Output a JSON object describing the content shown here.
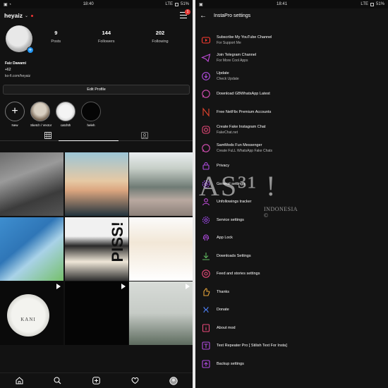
{
  "left": {
    "status": {
      "time": "18:40",
      "signal": "LTE",
      "battery": "51%"
    },
    "topbar": {
      "username": "heyaiz",
      "notif_count": "1"
    },
    "profile": {
      "stats": [
        {
          "value": "9",
          "label": "Posts"
        },
        {
          "value": "144",
          "label": "Followers"
        },
        {
          "value": "202",
          "label": "Following"
        }
      ],
      "name": "Faiz Dawami",
      "pronoun": "+62",
      "link": "ko-fi.com/heyaiz",
      "edit_label": "Edit Profile"
    },
    "highlights": [
      {
        "label": "New"
      },
      {
        "label": "Sketch / Vector"
      },
      {
        "label": "catchth"
      },
      {
        "label": "heleh"
      }
    ],
    "grid": {
      "piss_text": "PISS!",
      "lamp_text": "KANI"
    }
  },
  "right": {
    "status": {
      "time": "18:41",
      "signal": "LTE",
      "battery": "51%"
    },
    "title": "InstaPro settings",
    "items": [
      {
        "title": "Subscribe My YouTube Channel",
        "sub": "For Support Me",
        "icon": "youtube-icon",
        "color": "#ff3b30"
      },
      {
        "title": "Join Telegram Channel",
        "sub": "For More Cool Apps",
        "icon": "telegram-icon",
        "color": "#c04bd9"
      },
      {
        "title": "Update",
        "sub": "Check Update",
        "icon": "update-icon",
        "color": "#b04ce0"
      },
      {
        "title": "Download GBWhatsApp Latest",
        "sub": "",
        "icon": "whatsapp-icon",
        "color": "#d64fb5"
      },
      {
        "title": "Free NetFlix Premium Accounts",
        "sub": "",
        "icon": "netflix-icon",
        "color": "#e5442e"
      },
      {
        "title": "Create Fake Instagram Chat",
        "sub": "FakeChat.net",
        "icon": "instagram-icon",
        "color": "#e8497a"
      },
      {
        "title": "SamMods Fun Messenger",
        "sub": "Create FuLL WhatsApp Fake Chats",
        "icon": "whatsapp-icon",
        "color": "#d64fb5"
      },
      {
        "title": "Privacy",
        "sub": "",
        "icon": "lock-icon",
        "color": "#b04ce0"
      },
      {
        "title": "General settings",
        "sub": "",
        "icon": "gear-icon",
        "color": "#a44cf0"
      },
      {
        "title": "Unfollowings tracker",
        "sub": "",
        "icon": "user-icon",
        "color": "#c04bd9"
      },
      {
        "title": "Service settings",
        "sub": "",
        "icon": "service-gear-icon",
        "color": "#a44cf0"
      },
      {
        "title": "App Lock",
        "sub": "",
        "icon": "fingerprint-icon",
        "color": "#b04ce0"
      },
      {
        "title": "Downloads Settings",
        "sub": "",
        "icon": "download-icon",
        "color": "#5fb85f"
      },
      {
        "title": "Feed and stories settings",
        "sub": "",
        "icon": "feed-icon",
        "color": "#e8497a"
      },
      {
        "title": "Thanks",
        "sub": "",
        "icon": "thanks-icon",
        "color": "#e5a33a"
      },
      {
        "title": "Donate",
        "sub": "",
        "icon": "donate-icon",
        "color": "#4c7df0"
      },
      {
        "title": "About mod",
        "sub": "",
        "icon": "about-icon",
        "color": "#e8497a"
      },
      {
        "title": "Text Repeater Pro [ Stilish Text For Insta]",
        "sub": "",
        "icon": "text-icon",
        "color": "#b04ce0"
      },
      {
        "title": "Backup settings",
        "sub": "",
        "icon": "backup-icon",
        "color": "#b04ce0"
      }
    ]
  },
  "watermark": {
    "big": "AS³¹ !",
    "small": "INDONESIA ©"
  }
}
